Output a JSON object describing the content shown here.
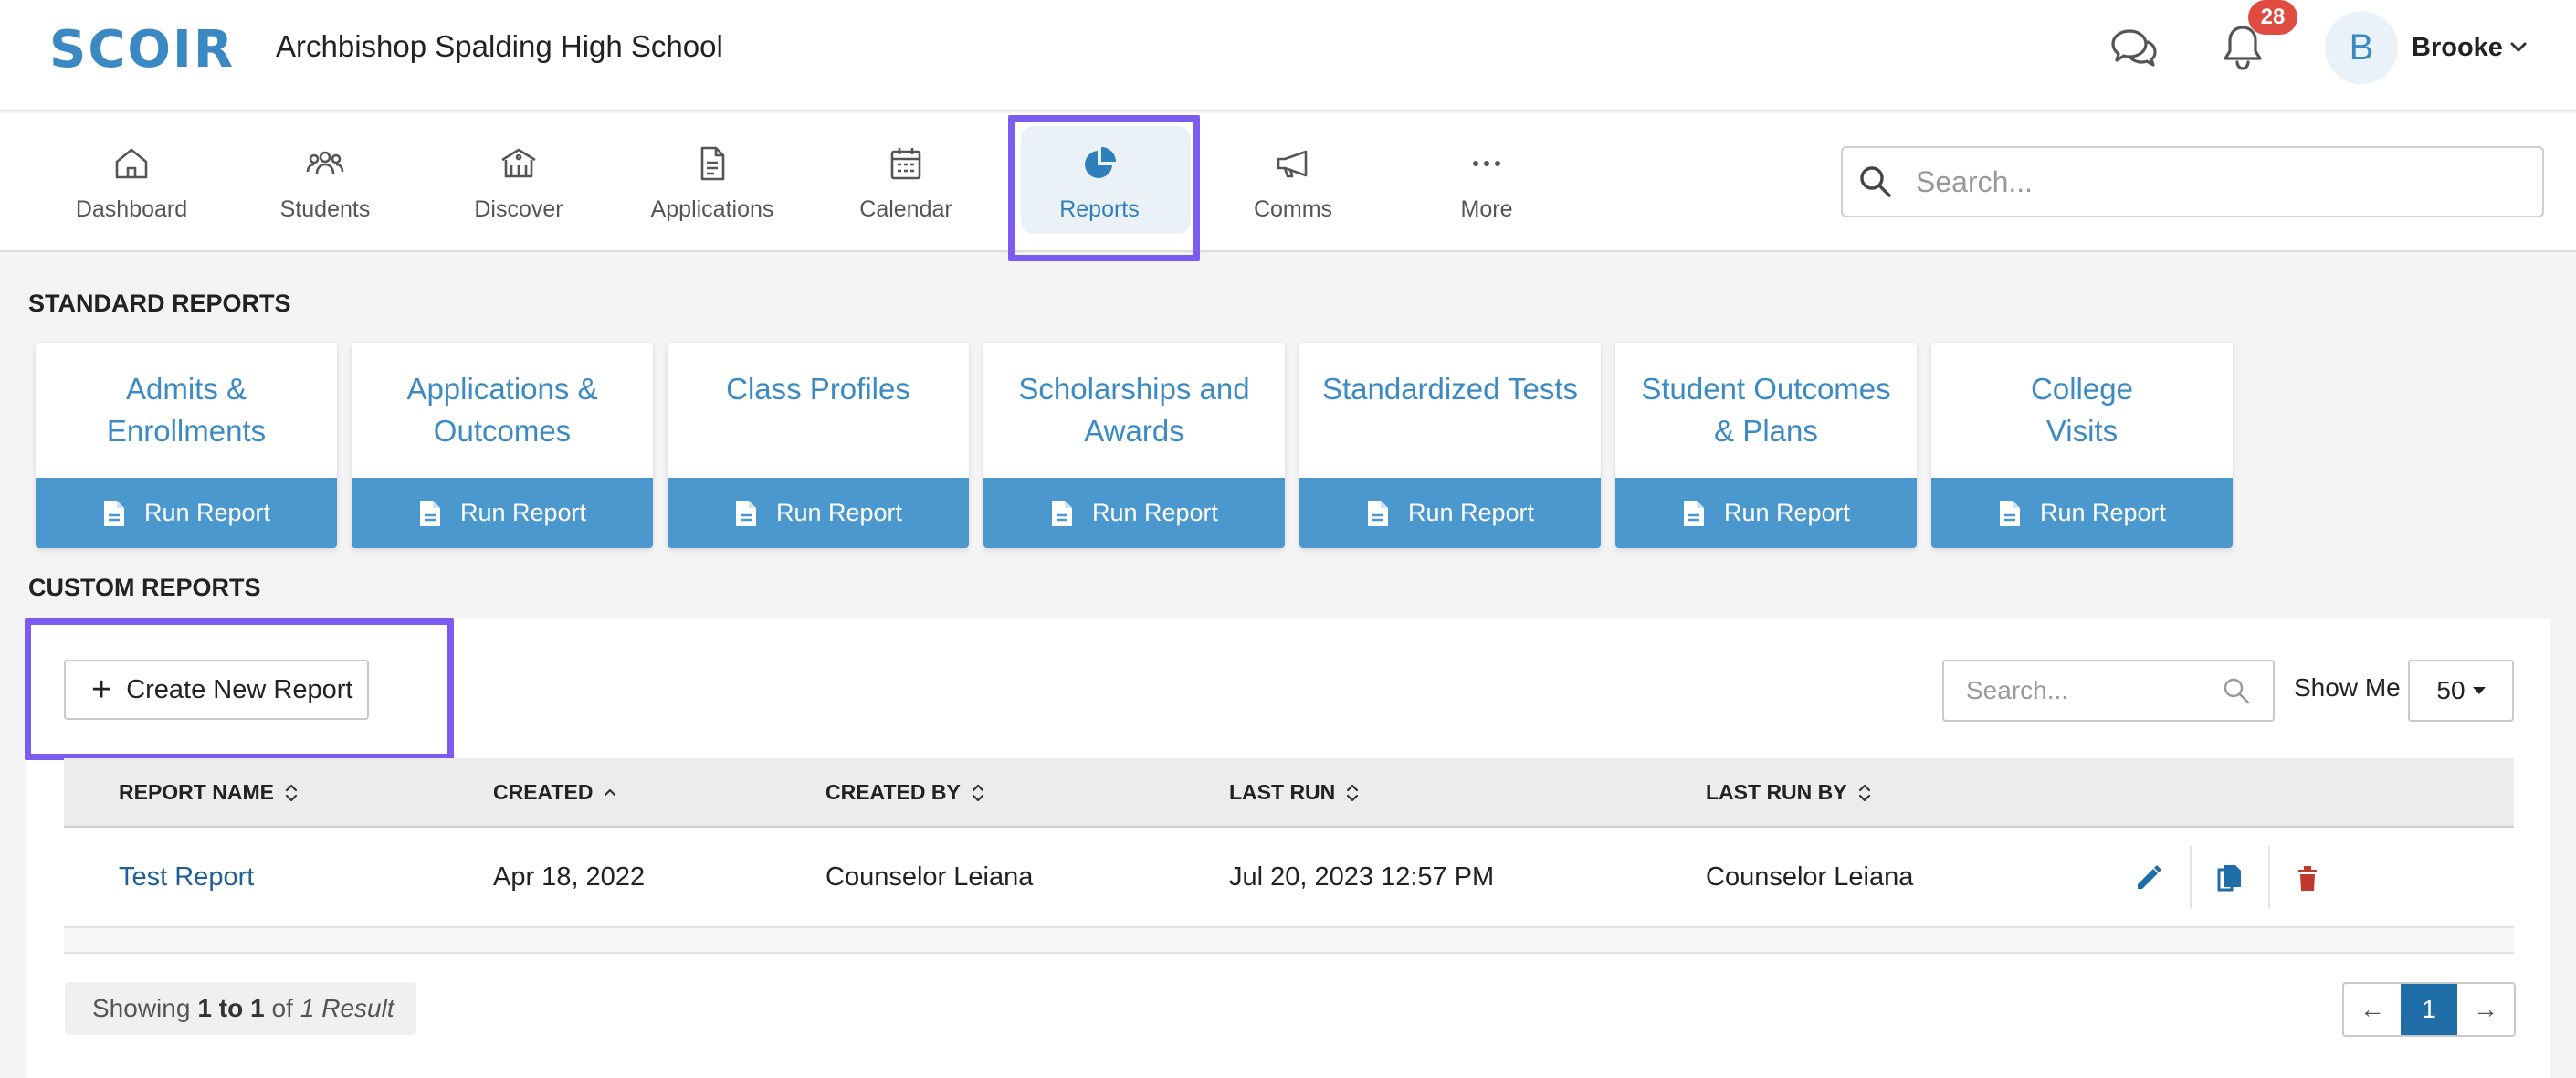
{
  "header": {
    "logo": "SCOIR",
    "school": "Archbishop Spalding High School",
    "notification_count": "28",
    "avatar_initial": "B",
    "user_name": "Brooke"
  },
  "nav": {
    "items": [
      {
        "label": "Dashboard",
        "icon": "home-icon"
      },
      {
        "label": "Students",
        "icon": "students-icon"
      },
      {
        "label": "Discover",
        "icon": "discover-icon"
      },
      {
        "label": "Applications",
        "icon": "document-icon"
      },
      {
        "label": "Calendar",
        "icon": "calendar-icon"
      },
      {
        "label": "Reports",
        "icon": "pie-chart-icon",
        "active": true
      },
      {
        "label": "Comms",
        "icon": "megaphone-icon"
      },
      {
        "label": "More",
        "icon": "more-icon"
      }
    ],
    "search_placeholder": "Search..."
  },
  "standard_reports": {
    "title": "STANDARD REPORTS",
    "button_label": "Run Report",
    "cards": [
      {
        "line1": "Admits &",
        "line2": "Enrollments"
      },
      {
        "line1": "Applications &",
        "line2": "Outcomes"
      },
      {
        "line1": "Class Profiles",
        "line2": ""
      },
      {
        "line1": "Scholarships and",
        "line2": "Awards"
      },
      {
        "line1": "Standardized Tests",
        "line2": ""
      },
      {
        "line1": "Student Outcomes",
        "line2": "& Plans"
      },
      {
        "line1": "College",
        "line2": "Visits"
      }
    ]
  },
  "custom_reports": {
    "title": "CUSTOM REPORTS",
    "create_label": "Create New Report",
    "search_placeholder": "Search...",
    "show_me_label": "Show Me",
    "show_me_value": "50",
    "columns": [
      "REPORT NAME",
      "CREATED",
      "CREATED BY",
      "LAST RUN",
      "LAST RUN BY"
    ],
    "rows": [
      {
        "name": "Test Report",
        "created": "Apr 18, 2022",
        "created_by": "Counselor Leiana",
        "last_run": "Jul 20, 2023 12:57 PM",
        "last_run_by": "Counselor Leiana"
      }
    ],
    "showing_prefix": "Showing",
    "showing_range": "1 to 1",
    "showing_of": "of",
    "showing_total": "1 Result",
    "page_prev": "←",
    "page_current": "1",
    "page_next": "→"
  },
  "colors": {
    "accent": "#3b89c2",
    "run_report_bg": "#4a98cd",
    "highlight": "#7b5cf0",
    "badge": "#e04b3f",
    "delete": "#c0392b"
  }
}
